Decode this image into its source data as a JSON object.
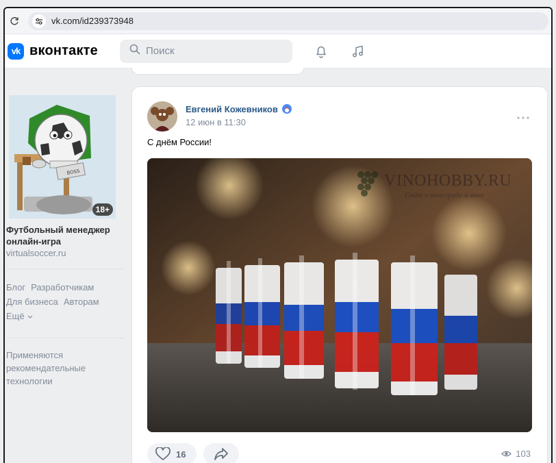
{
  "browser": {
    "url": "vk.com/id239373948"
  },
  "header": {
    "logo_mark": "vk",
    "logo_text": "вконтакте",
    "search_placeholder": "Поиск"
  },
  "sidebar": {
    "ad": {
      "age_rating": "18+",
      "title": "Футбольный менеджер онлайн-игра",
      "domain": "virtualsoccer.ru",
      "image_sign": "BOSS"
    },
    "footer_links": [
      "Блог",
      "Разработчикам",
      "Для бизнеса",
      "Авторам"
    ],
    "more_label": "Ещё",
    "recommendation_note": "Применяются рекомендательные технологии"
  },
  "post": {
    "author": "Евгений Кожевников",
    "date": "12 июн в 11:30",
    "text": "С днём России!",
    "photo": {
      "watermark_title": "VINOHOBBY.RU",
      "watermark_subtitle": "Сайт о винограде и вине"
    },
    "likes": "16",
    "views": "103"
  },
  "colors": {
    "accent": "#0077ff",
    "link": "#2a5885",
    "muted": "#818c99",
    "background": "#edeef0"
  },
  "icons": {
    "reload": "reload-icon",
    "site_settings": "site-settings-icon",
    "search": "search-icon",
    "notifications": "bell-icon",
    "music": "music-note-icon",
    "more": "more-horizontal-icon",
    "like": "heart-icon",
    "share": "share-icon",
    "views": "eye-icon"
  }
}
